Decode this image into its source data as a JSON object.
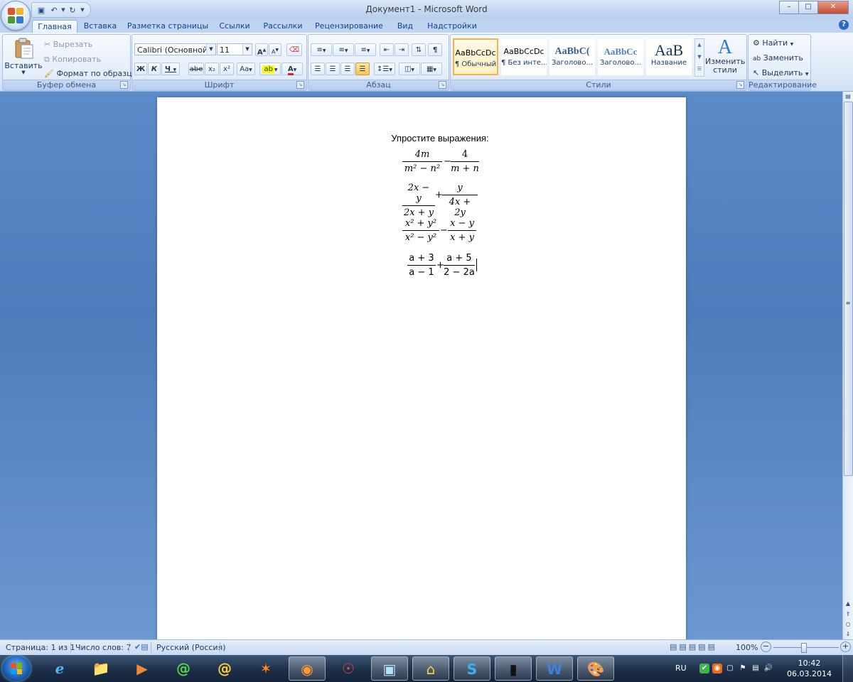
{
  "window": {
    "title": "Документ1 - Microsoft Word",
    "controls": {
      "minimize": "–",
      "maximize": "□",
      "close": "✕"
    }
  },
  "tabs": [
    "Главная",
    "Вставка",
    "Разметка страницы",
    "Ссылки",
    "Рассылки",
    "Рецензирование",
    "Вид",
    "Надстройки"
  ],
  "active_tab": "Главная",
  "ribbon": {
    "clipboard": {
      "label": "Буфер обмена",
      "paste": "Вставить",
      "cut": "Вырезать",
      "copy": "Копировать",
      "format_painter": "Формат по образцу"
    },
    "font": {
      "label": "Шрифт",
      "font_name": "Calibri (Основной те",
      "font_size": "11",
      "bold": "Ж",
      "italic": "К",
      "underline": "Ч",
      "strike": "abe",
      "subscript": "x₂",
      "superscript": "x²",
      "change_case": "Aa",
      "grow": "A",
      "shrink": "A"
    },
    "paragraph": {
      "label": "Абзац"
    },
    "styles": {
      "label": "Стили",
      "items": [
        {
          "sample": "AaBbCcDc",
          "name": "¶ Обычный"
        },
        {
          "sample": "AaBbCcDc",
          "name": "¶ Без инте..."
        },
        {
          "sample": "AaBbC(",
          "name": "Заголово..."
        },
        {
          "sample": "AaBbCc",
          "name": "Заголово..."
        },
        {
          "sample": "AaB",
          "name": "Название"
        }
      ],
      "change_styles": "Изменить стили"
    },
    "editing": {
      "label": "Редактирование",
      "find": "Найти",
      "replace": "Заменить",
      "select": "Выделить"
    }
  },
  "document": {
    "heading": "Упростите выражения:",
    "expressions": [
      {
        "num1": "4m",
        "den1": "m² − n²",
        "op": "−",
        "num2": "4",
        "den2": "m + n"
      },
      {
        "num1": "2x − y",
        "den1": "2x + y",
        "op": "+",
        "num2": "y",
        "den2": "4x + 2y"
      },
      {
        "num1": "x² + y²",
        "den1": "x² − y²",
        "op": "−",
        "num2": "x − y",
        "den2": "x + y"
      },
      {
        "num1": "a + 3",
        "den1": "a − 1",
        "op": "+",
        "num2": "a + 5",
        "den2": "2 − 2a"
      }
    ]
  },
  "statusbar": {
    "page": "Страница: 1 из 1",
    "words": "Число слов: 7",
    "language": "Русский (Россия)",
    "zoom": "100%"
  },
  "taskbar": {
    "language": "RU",
    "time": "10:42",
    "date": "06.03.2014"
  }
}
